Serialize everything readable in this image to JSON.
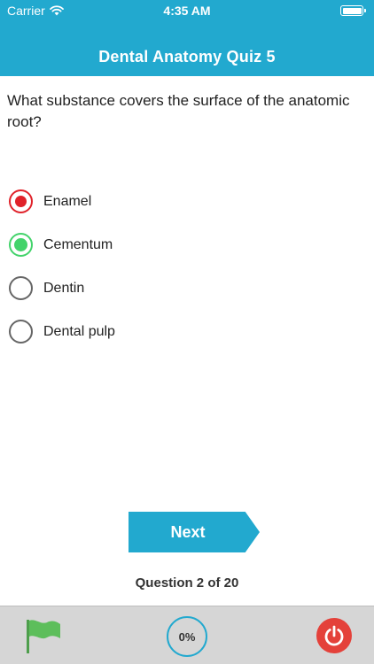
{
  "status_bar": {
    "carrier": "Carrier",
    "time": "4:35 AM"
  },
  "header": {
    "title": "Dental Anatomy Quiz 5"
  },
  "question": {
    "text": "What substance covers the surface of the anatomic root?"
  },
  "options": [
    {
      "label": "Enamel",
      "state": "wrong-selected"
    },
    {
      "label": "Cementum",
      "state": "correct"
    },
    {
      "label": "Dentin",
      "state": "unselected"
    },
    {
      "label": "Dental pulp",
      "state": "unselected"
    }
  ],
  "next_button": {
    "label": "Next"
  },
  "progress": {
    "text": "Question 2 of 20"
  },
  "toolbar": {
    "score_percent": "0%"
  },
  "colors": {
    "accent": "#22A9CF",
    "wrong": "#E0222A",
    "correct": "#43D36B",
    "power": "#E4413A",
    "flag": "#5DBE5B"
  }
}
